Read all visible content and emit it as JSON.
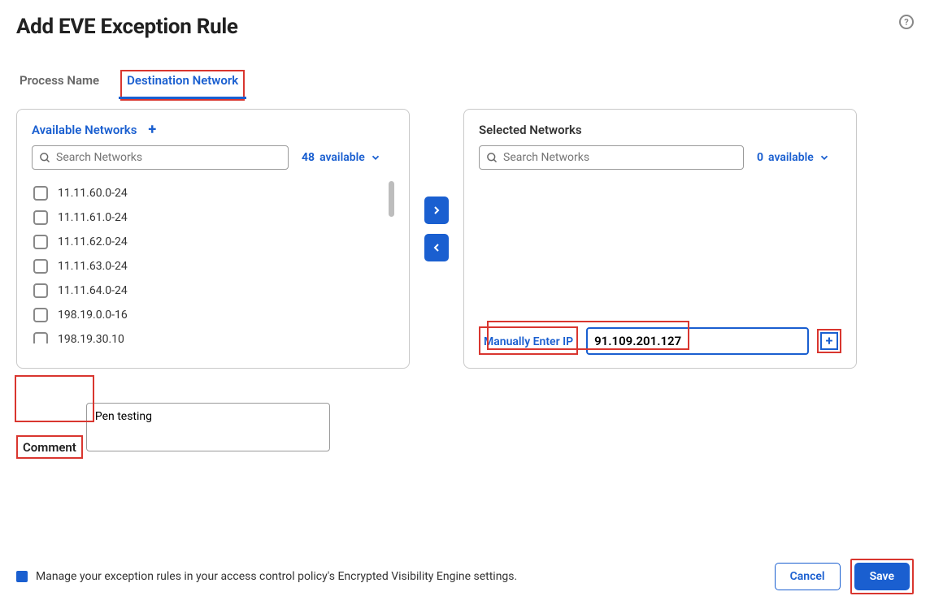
{
  "header": {
    "title": "Add EVE Exception Rule"
  },
  "tabs": [
    {
      "label": "Process Name",
      "active": false
    },
    {
      "label": "Destination Network",
      "active": true
    }
  ],
  "available": {
    "title": "Available Networks",
    "search_placeholder": "Search Networks",
    "count": "48",
    "count_label": "available",
    "items": [
      "11.11.60.0-24",
      "11.11.61.0-24",
      "11.11.62.0-24",
      "11.11.63.0-24",
      "11.11.64.0-24",
      "198.19.0.0-16",
      "198.19.30.10"
    ]
  },
  "selected": {
    "title": "Selected Networks",
    "search_placeholder": "Search Networks",
    "count": "0",
    "count_label": "available"
  },
  "manual": {
    "label": "Manually Enter IP",
    "value": "91.109.201.127",
    "add": "+"
  },
  "comment": {
    "label": "Comment",
    "value": "Pen testing"
  },
  "footer": {
    "note": "Manage your exception rules in your access control policy's Encrypted Visibility Engine settings.",
    "cancel": "Cancel",
    "save": "Save"
  }
}
